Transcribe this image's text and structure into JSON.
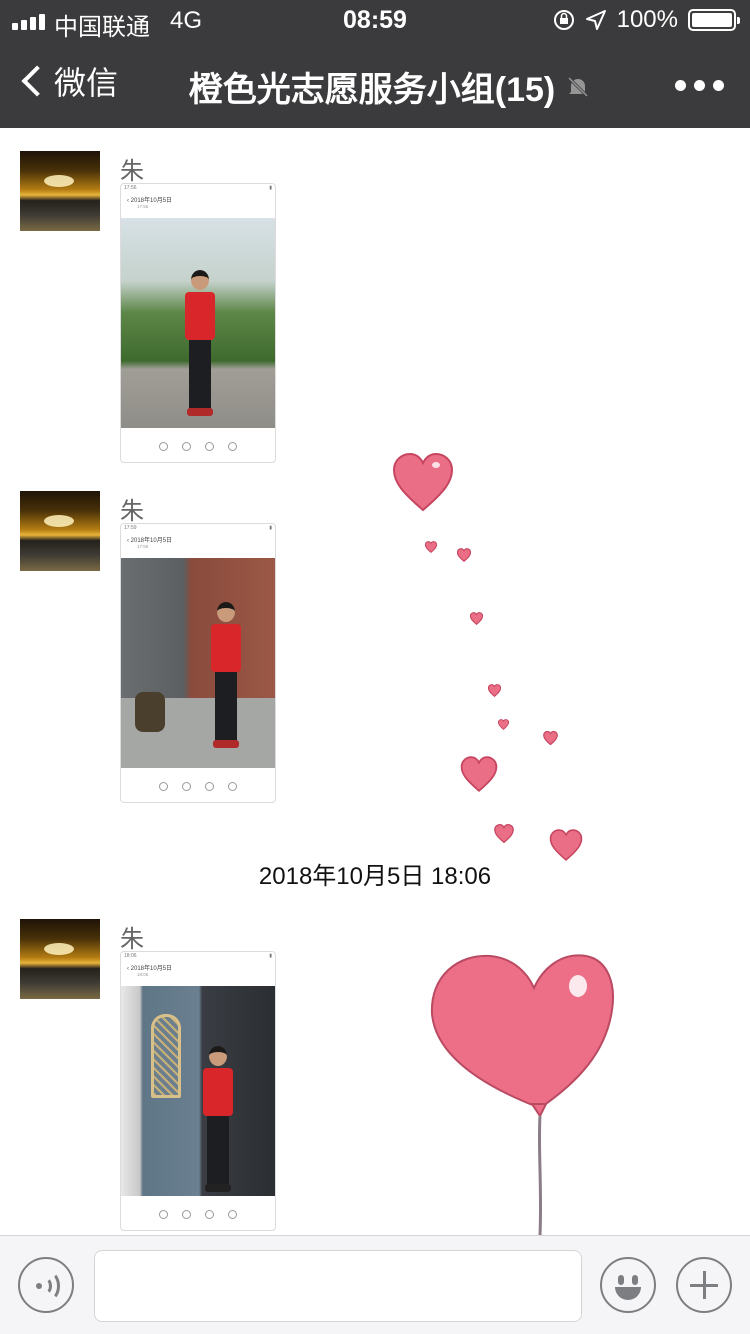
{
  "status_bar": {
    "carrier": "中国联通",
    "network": "4G",
    "time": "08:59",
    "battery": "100%"
  },
  "nav": {
    "back_label": "微信",
    "title": "橙色光志愿服务小组(15)"
  },
  "messages": [
    {
      "sender": "朱瑞",
      "shot_status_time": "17:56",
      "shot_header_date": "2018年10月5日",
      "shot_header_time": "17:56"
    },
    {
      "sender": "朱瑞",
      "shot_status_time": "17:59",
      "shot_header_date": "2018年10月5日",
      "shot_header_time": "17:59"
    },
    {
      "sender": "朱瑞",
      "shot_status_time": "18:06",
      "shot_header_date": "2018年10月5日",
      "shot_header_time": "18:05"
    }
  ],
  "timestamp": "2018年10月5日 18:06",
  "input": {
    "value": ""
  },
  "colors": {
    "nav_bg": "#3b3b3d",
    "heart": "#e8607a",
    "icon_gray": "#7d7e82"
  },
  "icons": {
    "back": "chevron-left-icon",
    "mute": "bell-slash-icon",
    "more": "ellipsis-icon",
    "voice": "voice-icon",
    "emoji": "smiley-icon",
    "plus": "plus-icon"
  }
}
